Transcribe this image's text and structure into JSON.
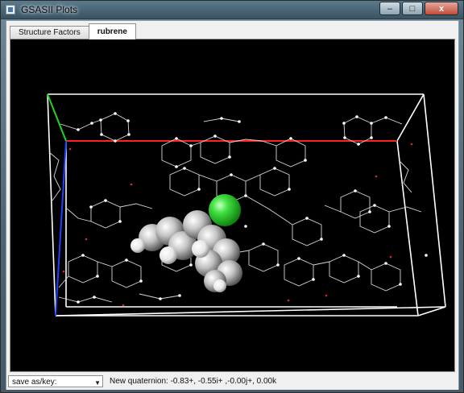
{
  "window": {
    "title": "GSASII Plots",
    "minimize_glyph": "–",
    "maximize_glyph": "□",
    "close_glyph": "x"
  },
  "tabs": [
    {
      "label": "Structure Factors",
      "active": false
    },
    {
      "label": "rubrene",
      "active": true
    }
  ],
  "bottom": {
    "save_select": {
      "value": "save as/key:"
    },
    "status_text": "New quaternion: -0.83+, -0.55i+ ,-0.00j+, 0.00k"
  },
  "colors": {
    "background": "#000000",
    "cell_edge": "#ffffff",
    "axis_a": "#ff2020",
    "axis_b": "#20d020",
    "axis_c": "#2040ff",
    "selected_atom": "#2fd62f",
    "carbon_atom": "#bfbfbf",
    "hydrogen_atom": "#ffffff"
  },
  "icons": {
    "app": "gsas-window-icon",
    "dropdown": "chevron-down-icon"
  }
}
